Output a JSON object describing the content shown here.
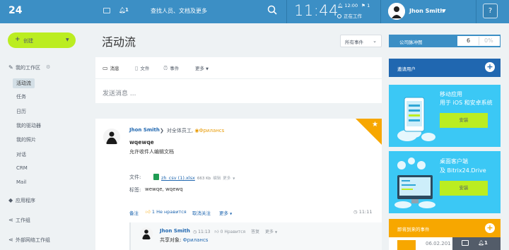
{
  "header": {
    "logo": "24",
    "notifications_count": "1",
    "search_placeholder": "查找人员、文档及更多",
    "clock": "11:44",
    "alarm_time": "12:00",
    "alarm_count": "1",
    "work_status": "正在工作",
    "user_name": "Jhon Smith",
    "help": "?"
  },
  "sidebar": {
    "create_label": "创建",
    "workspace_label": "我的工作区",
    "items": [
      {
        "label": "活动流"
      },
      {
        "label": "任务"
      },
      {
        "label": "日历"
      },
      {
        "label": "我的驱动器"
      },
      {
        "label": "我的照片"
      },
      {
        "label": "对话"
      },
      {
        "label": "CRM"
      },
      {
        "label": "Mail"
      }
    ],
    "apps_label": "应用程序",
    "groups_label": "工作组",
    "external_groups_label": "外部网络工作组"
  },
  "main": {
    "title": "活动流",
    "filter_label": "所有事件",
    "composer": {
      "tabs": [
        {
          "label": "消息"
        },
        {
          "label": "文件"
        },
        {
          "label": "事件"
        },
        {
          "label": "更多"
        }
      ],
      "placeholder": "发送消息 ..."
    },
    "post": {
      "author": "Jhon Smith",
      "recipients_prefix": "对全体员工,",
      "recipients_group": "Фрилансs",
      "title": "wqewqe",
      "body": "允许收件人编辑文档",
      "files_label": "文件:",
      "file_name": "zh_csv (1).xlsx",
      "file_size": "663 Kb",
      "file_edit": "编辑",
      "file_more": "更多",
      "tags_label": "标签:",
      "tags": "wewqe, wqewq",
      "actions": {
        "comment": "备注",
        "like": "1 Не нравится",
        "unfollow": "取消关注",
        "more": "更多"
      },
      "time": "11:11",
      "comment": {
        "author": "Jhon Smith",
        "time": "11:13",
        "like": "0 Нравится",
        "reply": "答复",
        "more": "更多",
        "shared_label": "共享对象:",
        "shared_with": "Фрилансs"
      }
    }
  },
  "right": {
    "pulse_label": "公司脉冲图",
    "pulse_value": "6",
    "pulse_percent": "0%",
    "invite_label": "邀请用户",
    "mobile_line1": "移动应用",
    "mobile_line2": "用于 iOS 和安卓系统",
    "mobile_install": "安装",
    "desktop_line1": "桌面客户端",
    "desktop_line2": "及 Bitrix24.Drive",
    "desktop_install": "安装",
    "events_label": "即将到来的事件",
    "events_date": "06.02.201",
    "chat_count": "1"
  }
}
